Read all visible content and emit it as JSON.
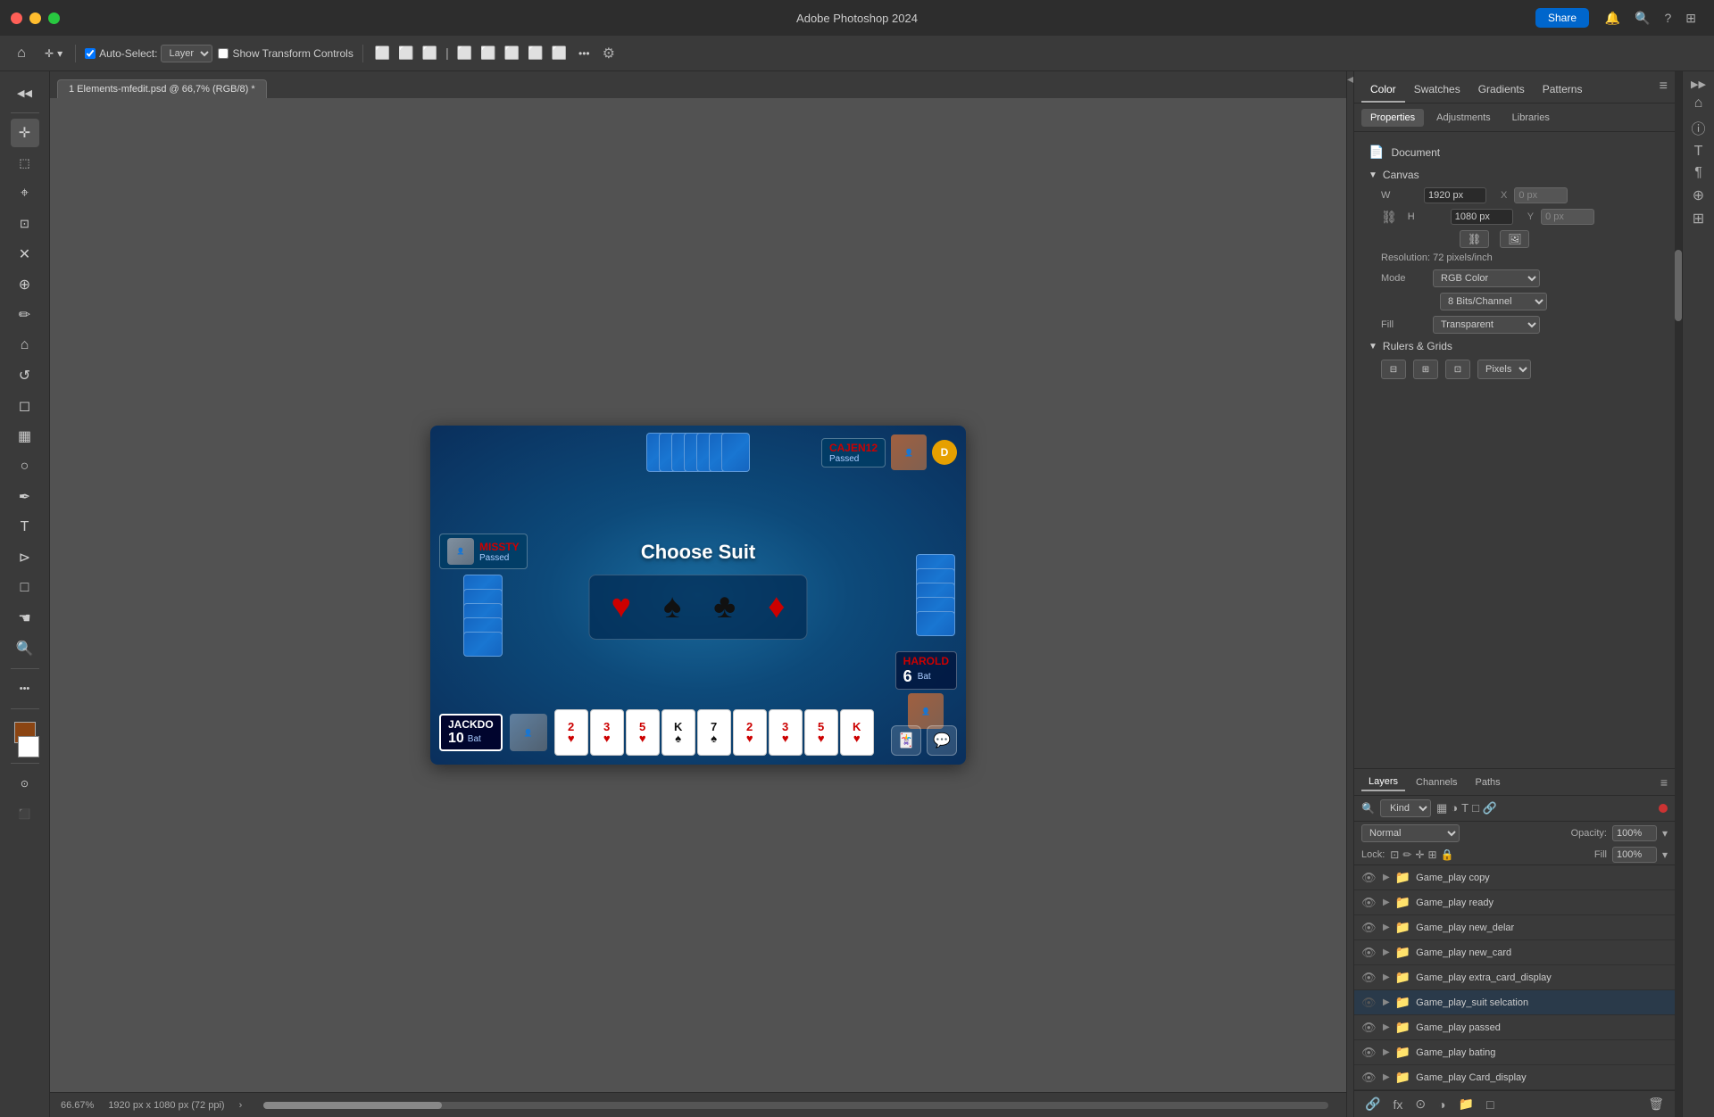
{
  "titlebar": {
    "title": "Adobe Photoshop 2024",
    "share_label": "Share",
    "traffic_lights": [
      "red",
      "yellow",
      "green"
    ]
  },
  "toolbar": {
    "home_icon": "⌂",
    "move_icon": "✛",
    "auto_select_label": "Auto-Select:",
    "layer_option": "Layer",
    "show_transform_label": "Show Transform Controls",
    "more_icon": "•••",
    "gear_icon": "⚙"
  },
  "canvas_tab": {
    "label": "1 Elements-mfedit.psd @ 66,7% (RGB/8) *"
  },
  "game": {
    "choose_suit_title": "Choose Suit",
    "suit_heart": "♥",
    "suit_spade": "♠",
    "suit_club": "♣",
    "suit_diamond": "♦",
    "player_top_name": "CAJEN12",
    "player_top_status": "Passed",
    "player_top_dealer": "D",
    "player_left_name": "MISSTY",
    "player_left_status": "Passed",
    "player_bottom_name": "JACKDO",
    "player_bottom_score": "10",
    "player_bottom_bat": "Bat",
    "player_right_name": "HAROLD",
    "player_right_score": "6",
    "player_right_bat": "Bat",
    "hand_cards": [
      "2",
      "3",
      "5",
      "K",
      "7",
      "2",
      "3",
      "5",
      "K"
    ],
    "hand_card_suits": [
      "♥",
      "♥",
      "♥",
      "♠",
      "♠",
      "♥",
      "♥",
      "♥",
      "♥"
    ]
  },
  "status_bar": {
    "zoom": "66.67%",
    "dimensions": "1920 px x 1080 px (72 ppi)"
  },
  "right_panel": {
    "tabs": [
      "Color",
      "Swatches",
      "Gradients",
      "Patterns"
    ],
    "active_tab": "Color",
    "sub_tabs": [
      "Properties",
      "Adjustments",
      "Libraries"
    ],
    "active_sub_tab": "Properties",
    "doc_label": "Document",
    "canvas_section": "Canvas",
    "canvas_w": "1920 px",
    "canvas_h": "1080 px",
    "canvas_x": "0 px",
    "canvas_y": "0 px",
    "resolution_text": "Resolution: 72 pixels/inch",
    "mode_label": "Mode",
    "mode_value": "RGB Color",
    "bits_value": "8 Bits/Channel",
    "fill_label": "Fill",
    "fill_value": "Transparent",
    "rulers_section": "Rulers & Grids",
    "rulers_unit": "Pixels"
  },
  "layers_panel": {
    "tabs": [
      "Layers",
      "Channels",
      "Paths"
    ],
    "active_tab": "Layers",
    "kind_label": "Kind",
    "blend_mode": "Normal",
    "opacity_label": "Opacity:",
    "opacity_value": "100%",
    "lock_label": "Lock:",
    "fill_label": "Fill",
    "fill_value": "100%",
    "layers": [
      {
        "name": "Game_play copy",
        "visible": true
      },
      {
        "name": "Game_play ready",
        "visible": true
      },
      {
        "name": "Game_play new_delar",
        "visible": true
      },
      {
        "name": "Game_play new_card",
        "visible": true
      },
      {
        "name": "Game_play extra_card_display",
        "visible": true
      },
      {
        "name": "Game_play_suit selcation",
        "visible": false
      },
      {
        "name": "Game_play passed",
        "visible": true
      },
      {
        "name": "Game_play bating",
        "visible": true
      },
      {
        "name": "Game_play Card_display",
        "visible": true
      }
    ]
  }
}
